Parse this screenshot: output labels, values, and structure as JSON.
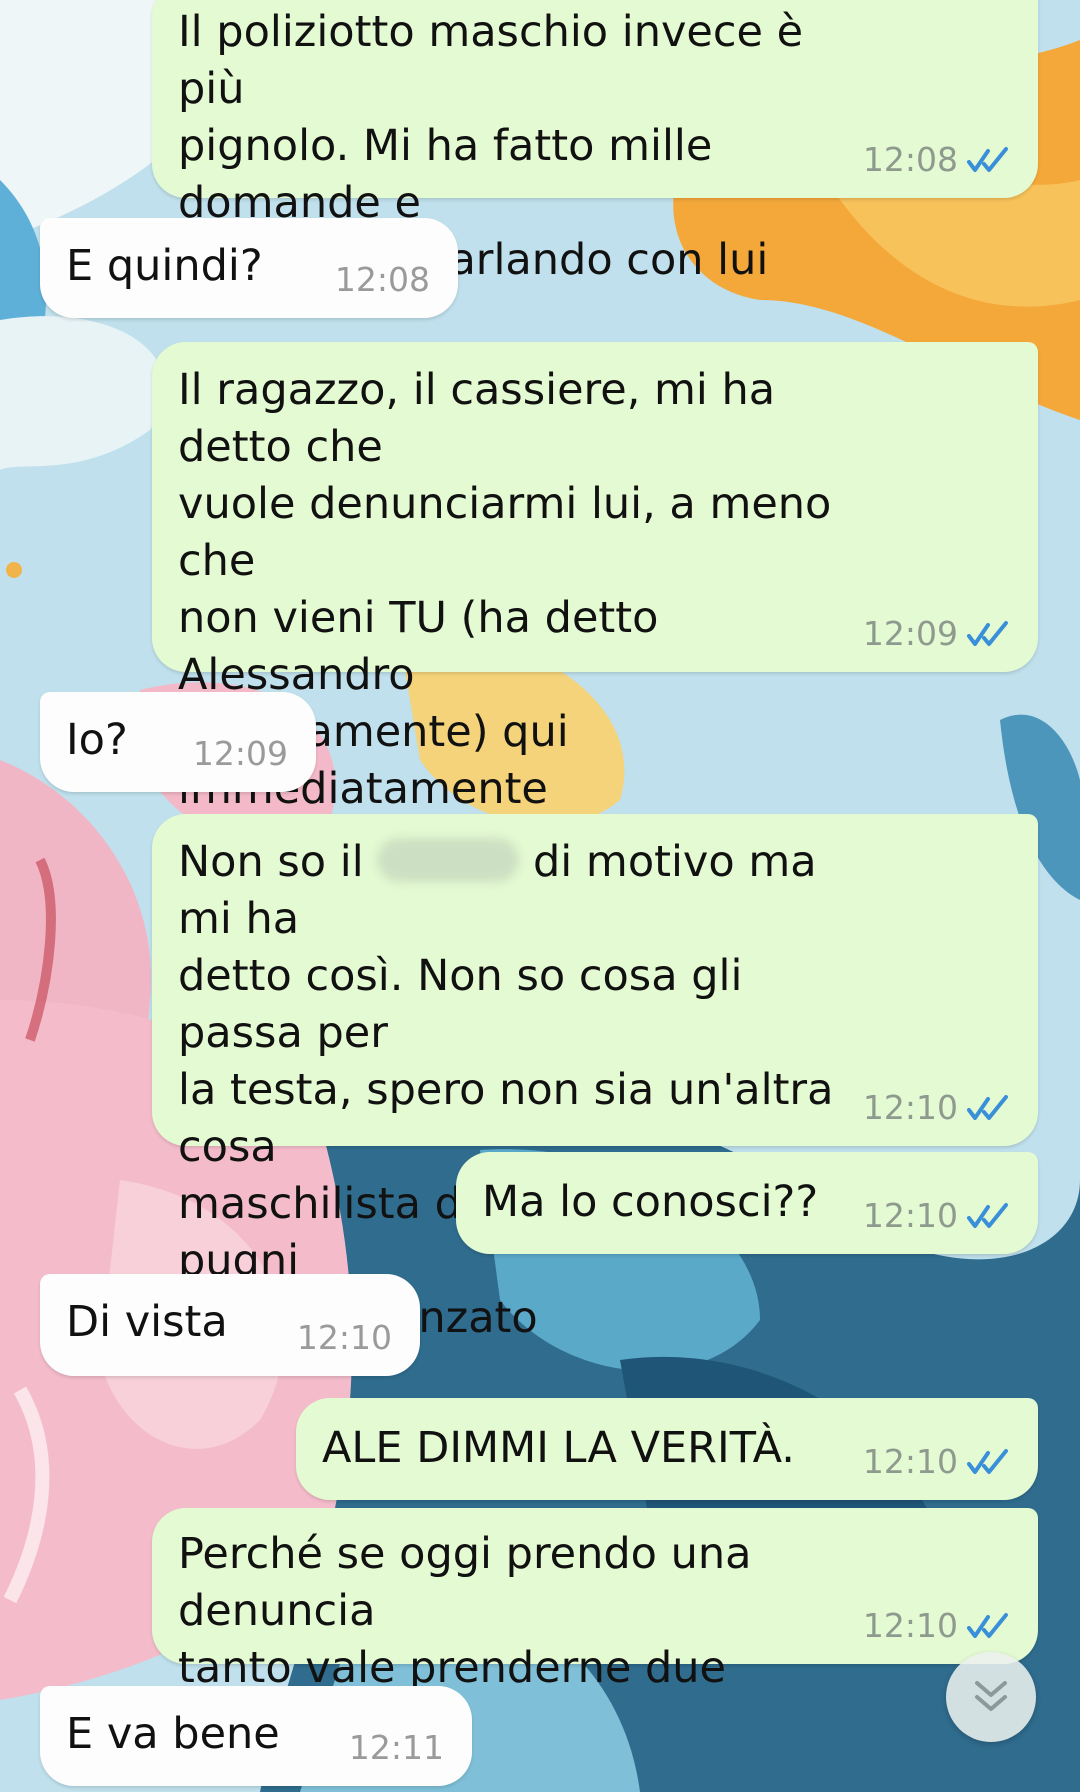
{
  "colors": {
    "outgoing_bubble": "#e4fad2",
    "incoming_bubble": "#fdfdfd",
    "read_ticks": "#3a8fd9",
    "timestamp": "#8f9a8f"
  },
  "messages": [
    {
      "direction": "out",
      "text": "Il poliziotto maschio invece è più\npignolo. Mi ha fatto mille domande e\nadesso sta parlando con lui",
      "time": "12:08",
      "status": "read"
    },
    {
      "direction": "in",
      "text": "E quindi?",
      "time": "12:08"
    },
    {
      "direction": "out",
      "text": "Il ragazzo, il cassiere, mi ha detto che\nvuole denunciarmi lui, a meno che\nnon vieni TU (ha detto Alessandro\nprecisamente) qui immediatamente",
      "time": "12:09",
      "status": "read"
    },
    {
      "direction": "in",
      "text": "Io?",
      "time": "12:09"
    },
    {
      "direction": "out",
      "text_before_redaction": "Non so il",
      "text_after_redaction": "di motivo ma mi ha\ndetto così. Non so cosa gli passa per\nla testa, spero non sia un'altra cosa\nmaschilista del tipo la risolvo a pugni\ncol tuo fidanzato",
      "time": "12:10",
      "status": "read"
    },
    {
      "direction": "out",
      "text": "Ma lo conosci??",
      "time": "12:10",
      "status": "read"
    },
    {
      "direction": "in",
      "text": "Di vista",
      "time": "12:10"
    },
    {
      "direction": "out",
      "text": "ALE DIMMI LA VERITÀ.",
      "time": "12:10",
      "status": "read"
    },
    {
      "direction": "out",
      "text": "Perché se oggi prendo una denuncia\ntanto vale prenderne due",
      "time": "12:10",
      "status": "read"
    },
    {
      "direction": "in",
      "text": "E va bene",
      "time": "12:11"
    }
  ],
  "scroll_button": {
    "icon": "double-chevron-down-icon"
  }
}
